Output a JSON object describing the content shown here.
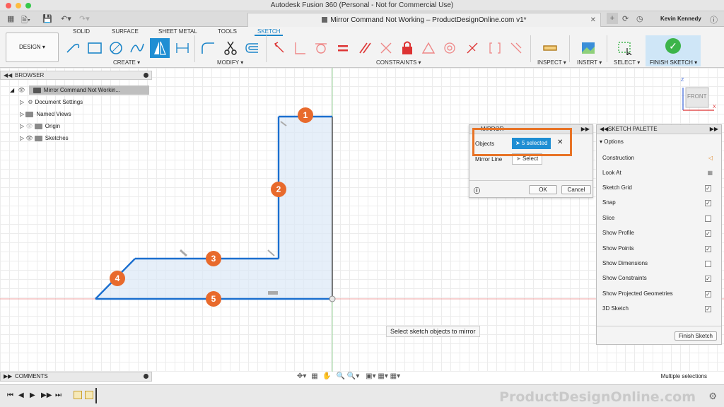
{
  "app_title": "Autodesk Fusion 360 (Personal - Not for Commercial Use)",
  "doc_tab": "Mirror Command Not Working – ProductDesignOnline.com v1*",
  "user_name": "Kevin Kennedy",
  "workspace_tabs": [
    "SOLID",
    "SURFACE",
    "SHEET METAL",
    "TOOLS",
    "SKETCH"
  ],
  "active_workspace_tab": "SKETCH",
  "design_button": "DESIGN ▾",
  "groups": {
    "create": "CREATE ▾",
    "modify": "MODIFY ▾",
    "constraints": "CONSTRAINTS ▾",
    "inspect": "INSPECT ▾",
    "insert": "INSERT ▾",
    "select": "SELECT ▾",
    "finish": "FINISH SKETCH ▾"
  },
  "browser": {
    "title": "BROWSER",
    "root": "Mirror Command Not Workin...",
    "items": [
      "Document Settings",
      "Named Views",
      "Origin",
      "Sketches"
    ]
  },
  "mirror_dialog": {
    "title": "MIRROR",
    "objects_label": "Objects",
    "objects_value": "5 selected",
    "mirror_line_label": "Mirror Line",
    "mirror_line_value": "Select",
    "ok": "OK",
    "cancel": "Cancel"
  },
  "palette": {
    "title": "SKETCH PALETTE",
    "section": "Options",
    "rows": [
      {
        "label": "Construction",
        "checked": null
      },
      {
        "label": "Look At",
        "checked": null
      },
      {
        "label": "Sketch Grid",
        "checked": true
      },
      {
        "label": "Snap",
        "checked": true
      },
      {
        "label": "Slice",
        "checked": false
      },
      {
        "label": "Show Profile",
        "checked": true
      },
      {
        "label": "Show Points",
        "checked": true
      },
      {
        "label": "Show Dimensions",
        "checked": false
      },
      {
        "label": "Show Constraints",
        "checked": true
      },
      {
        "label": "Show Projected Geometries",
        "checked": true
      },
      {
        "label": "3D Sketch",
        "checked": true
      }
    ],
    "finish_button": "Finish Sketch"
  },
  "tooltip": "Select sketch objects to mirror",
  "comments": "COMMENTS",
  "status_text": "Multiple selections",
  "brand": "ProductDesignOnline.com",
  "viewcube": {
    "face": "FRONT",
    "axis_z": "Z",
    "axis_x": "X"
  },
  "markers": [
    "1",
    "2",
    "3",
    "4",
    "5"
  ],
  "colors": {
    "accent": "#1f8ed3",
    "sketch_line": "#1b6fcf",
    "marker": "#e86a2c",
    "highlight_box": "#e87326",
    "finish_green": "#3cb44a"
  }
}
